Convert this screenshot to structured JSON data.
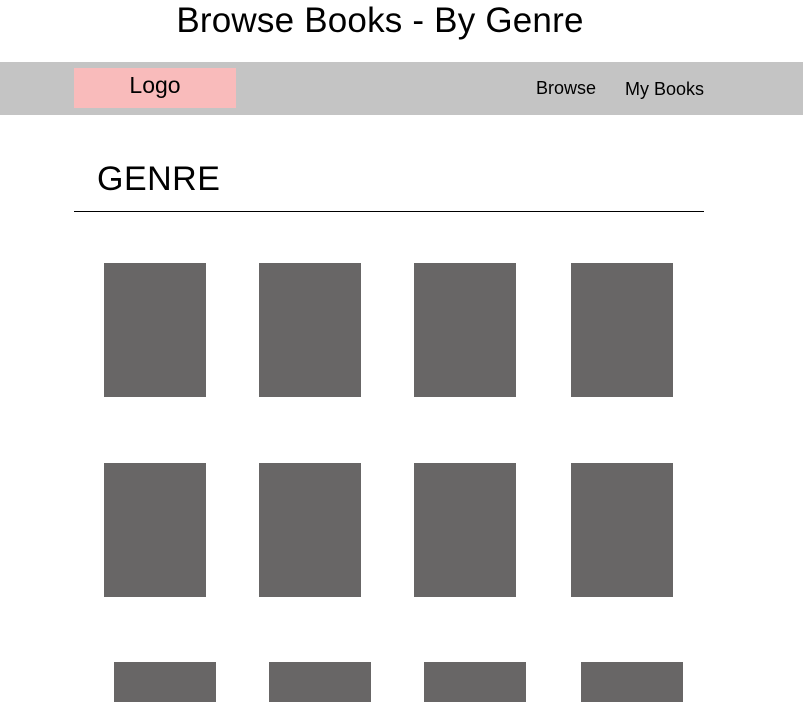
{
  "page": {
    "title": "Browse Books - By Genre"
  },
  "navbar": {
    "logo_label": "Logo",
    "links": [
      {
        "label": "Browse"
      },
      {
        "label": "My Books"
      }
    ]
  },
  "genre_section": {
    "heading": "GENRE",
    "book_placeholder_color": "#686666",
    "rows": [
      {
        "books": [
          {
            "cover": "placeholder"
          },
          {
            "cover": "placeholder"
          },
          {
            "cover": "placeholder"
          },
          {
            "cover": "placeholder"
          }
        ]
      },
      {
        "books": [
          {
            "cover": "placeholder"
          },
          {
            "cover": "placeholder"
          },
          {
            "cover": "placeholder"
          },
          {
            "cover": "placeholder"
          }
        ]
      },
      {
        "books": [
          {
            "cover": "placeholder"
          },
          {
            "cover": "placeholder"
          },
          {
            "cover": "placeholder"
          },
          {
            "cover": "placeholder"
          }
        ]
      }
    ]
  },
  "colors": {
    "navbar_background": "#c4c4c4",
    "logo_background": "#f9bbbb"
  }
}
